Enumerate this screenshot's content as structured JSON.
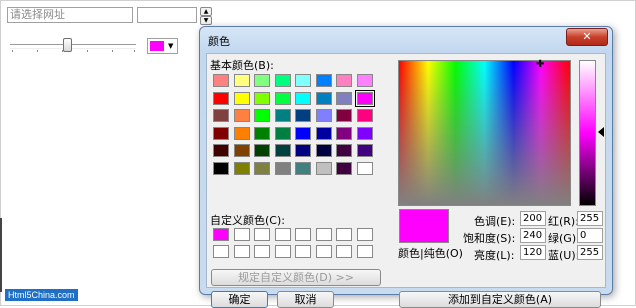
{
  "page": {
    "url_placeholder": "请选择网址",
    "spin_up": "▲",
    "spin_down": "▼",
    "dropdown_arrow": "▼",
    "selected_color": "#ff00ff",
    "watermark": "Html5China.com"
  },
  "dialog": {
    "title": "颜色",
    "close_label": "✕",
    "basic_colors_label": "基本颜色(B):",
    "custom_colors_label": "自定义颜色(C):",
    "define_custom_label": "规定自定义颜色(D) >>",
    "ok_label": "确定",
    "cancel_label": "取消",
    "color_solid_label": "颜色|纯色(O)",
    "add_custom_label": "添加到自定义颜色(A)",
    "crosshair": "✚",
    "fields": {
      "hue_label": "色调(E):",
      "hue_value": "200",
      "sat_label": "饱和度(S):",
      "sat_value": "240",
      "lum_label": "亮度(L):",
      "lum_value": "120",
      "red_label": "红(R):",
      "red_value": "255",
      "green_label": "绿(G):",
      "green_value": "0",
      "blue_label": "蓝(U):",
      "blue_value": "255"
    },
    "basic_colors": [
      [
        "#ff8080",
        "#ffff80",
        "#80ff80",
        "#00ff80",
        "#80ffff",
        "#0080ff",
        "#ff80c0",
        "#ff80ff"
      ],
      [
        "#ff0000",
        "#ffff00",
        "#80ff00",
        "#00ff40",
        "#00ffff",
        "#0080c0",
        "#8080c0",
        "#ff00ff"
      ],
      [
        "#804040",
        "#ff8040",
        "#00ff00",
        "#008080",
        "#004080",
        "#8080ff",
        "#800040",
        "#ff0080"
      ],
      [
        "#800000",
        "#ff8000",
        "#008000",
        "#008040",
        "#0000ff",
        "#0000a0",
        "#800080",
        "#8000ff"
      ],
      [
        "#400000",
        "#804000",
        "#004000",
        "#004040",
        "#000080",
        "#000040",
        "#400040",
        "#400080"
      ],
      [
        "#000000",
        "#808000",
        "#808040",
        "#808080",
        "#408080",
        "#c0c0c0",
        "#400040",
        "#ffffff"
      ]
    ],
    "selected_basic": {
      "row": 1,
      "col": 7
    },
    "custom_colors": [
      [
        "#ff00ff",
        "#ffffff",
        "#ffffff",
        "#ffffff",
        "#ffffff",
        "#ffffff",
        "#ffffff",
        "#ffffff"
      ],
      [
        "#ffffff",
        "#ffffff",
        "#ffffff",
        "#ffffff",
        "#ffffff",
        "#ffffff",
        "#ffffff",
        "#ffffff"
      ]
    ]
  }
}
